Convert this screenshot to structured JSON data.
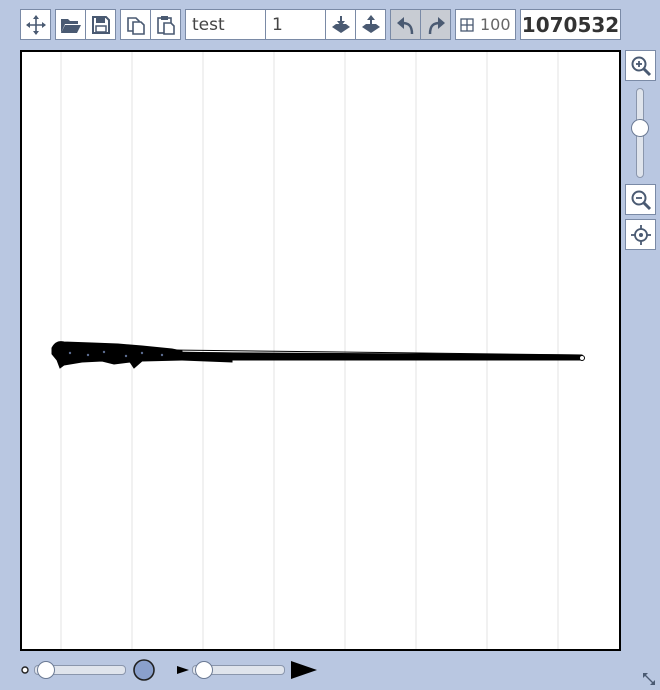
{
  "toolbar": {
    "name_value": "test",
    "index_value": "1",
    "grid_value": "100",
    "counter_value": "1070532"
  },
  "zoom": {
    "slider_level": 0.62
  },
  "bottom": {
    "brush_size_level": 0.05,
    "speed_level": 0.05
  },
  "colors": {
    "background": "#b9c7e1",
    "accent_circle": "#8aa0cc",
    "icon": "#4a5a72"
  }
}
